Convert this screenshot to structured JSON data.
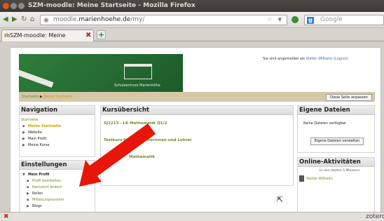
{
  "window": {
    "title": "SZM-moodle: Meine Startseite - Mozilla Firefox"
  },
  "toolbar": {
    "url_prefix": "moodle.",
    "url_host": "marienhoehe.de",
    "url_path": "/my/",
    "search_placeholder": "Google",
    "search_engine_label": "g"
  },
  "tab": {
    "title": "SZM-moodle: Meine Startseite"
  },
  "page": {
    "banner_caption": "Schulzentrum Marienhöhe",
    "login_prefix": "Sie sind angemeldet als",
    "login_user": "Stefan Wilhelm",
    "logout_label": "(Logout)",
    "breadcrumb": {
      "home": "Startseite",
      "separator": "▶",
      "current": "Meine Startseite"
    },
    "edit_page_button": "Diese Seite anpassen"
  },
  "navigation": {
    "title": "Navigation",
    "home": "Startseite",
    "items": [
      "Meine Startseite",
      "Website",
      "Mein Profil",
      "Meine Kurse"
    ]
  },
  "settings": {
    "title": "Einstellungen",
    "section": "Mein Profil",
    "items": [
      "Profil bearbeiten",
      "Kennwort ändern",
      "Rollen",
      "Mitteilungssystem",
      "Blogs"
    ]
  },
  "courses": {
    "title": "Kursübersicht",
    "items": [
      "SJ1213 - LK Mathematik Q1/2",
      "Testkurs für alle Lehrerinnen und Lehrer",
      "Mathematik"
    ]
  },
  "files": {
    "title": "Eigene Dateien",
    "empty_text": "Keine Dateien verfügbar",
    "manage_button": "Eigene Dateien verwalten"
  },
  "online": {
    "title": "Online-Aktivitäten",
    "subtitle": "(in den letzten 5 Minuten)",
    "user": "Stefan Wilhelm"
  },
  "statusbar": {
    "zotero_label": "zoterc"
  },
  "colors": {
    "link_green": "#6b8e23",
    "current_yellow": "#c8a000",
    "arrow_red": "#e8150b",
    "banner_green": "#2f7d3c"
  },
  "icons": [
    "back-icon",
    "forward-icon",
    "reload-icon",
    "home-icon",
    "star-icon",
    "close-icon",
    "new-tab-icon",
    "red-arrow-annotation"
  ]
}
